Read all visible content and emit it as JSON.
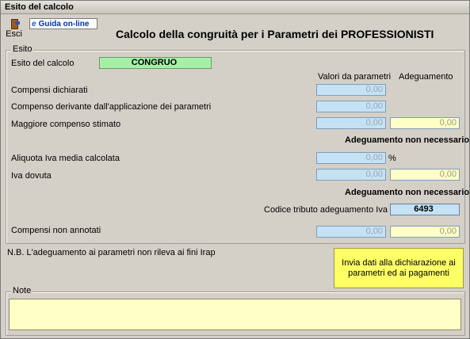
{
  "window": {
    "title": "Esito del calcolo"
  },
  "toolbar": {
    "exit_label": "Esci",
    "help_link": "Guida on-line"
  },
  "heading": "Calcolo della congruità per i Parametri dei PROFESSIONISTI",
  "esito_group": {
    "legend": "Esito",
    "result_label": "Esito del calcolo",
    "result_value": "CONGRUO",
    "col_header_params": "Valori da parametri",
    "col_header_adjust": "Adeguamento",
    "rows": {
      "compensi_dichiarati": {
        "label": "Compensi dichiarati",
        "param_value": "0,00"
      },
      "compenso_derivante": {
        "label": "Compenso derivante dall'applicazione dei parametri",
        "param_value": "0,00"
      },
      "maggiore_compenso": {
        "label": "Maggiore compenso stimato",
        "param_value": "0,00",
        "adjust_value": "0,00"
      },
      "aliquota_iva": {
        "label": "Aliquota Iva media calcolata",
        "param_value": "0,00",
        "unit": "%"
      },
      "iva_dovuta": {
        "label": "Iva dovuta",
        "param_value": "0,00",
        "adjust_value": "0,00"
      },
      "compensi_non_annotati": {
        "label": "Compensi non annotati",
        "param_value": "0,00",
        "adjust_value": "0,00"
      }
    },
    "status_1": "Adeguamento non necessario",
    "status_2": "Adeguamento non necessario",
    "codice_tributo_label": "Codice tributo adeguamento Iva",
    "codice_tributo_value": "6493"
  },
  "footnote": "N.B. L'adeguamento ai parametri non rileva ai fini Irap",
  "send_button": "Invia dati alla dichiarazione ai parametri ed ai pagamenti",
  "notes_group": {
    "legend": "Note",
    "value": ""
  }
}
